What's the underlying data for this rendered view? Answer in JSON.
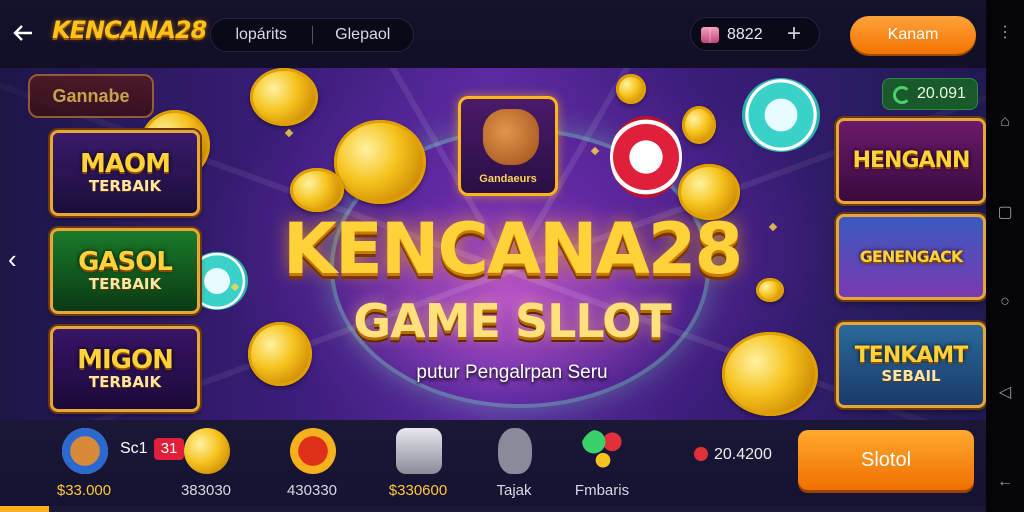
{
  "header": {
    "logo": "KENCANA28",
    "tabs": [
      "lopárits",
      "Glepaol"
    ],
    "coin_value": "8822",
    "action_button": "Kanam"
  },
  "banner": {
    "corner_brand": "Gannabe",
    "mascot_label": "Gandaeurs",
    "title": "KENCANA28",
    "subtitle": "GAME SLLOT",
    "tagline": "putur Pengalrpan Seru",
    "prize_value": "20.091",
    "left_tiles": [
      {
        "line1": "MAOM",
        "line2": "TERBAIK"
      },
      {
        "line1": "GASOL",
        "line2": "TERBAIK"
      },
      {
        "line1": "MIGON",
        "line2": "TERBAIK"
      }
    ],
    "right_tiles": [
      {
        "line1": "HENGANN",
        "line2": ""
      },
      {
        "line1": "GENENGACK",
        "line2": ""
      },
      {
        "line1": "TENKAMT",
        "line2": "SEBAIL"
      }
    ]
  },
  "bottom": {
    "badge_prefix": "Sc1",
    "badge_count": "31",
    "items": [
      {
        "caption": "$33.000",
        "icon": "dog-chip-icon"
      },
      {
        "caption": "383030",
        "icon": "gold-coin-icon"
      },
      {
        "caption": "430330",
        "icon": "bitcoin-icon"
      },
      {
        "caption": "$330600",
        "icon": "dice-cup-icon"
      },
      {
        "caption": "Tajak",
        "icon": "apple-icon"
      },
      {
        "caption": "Fmbaris",
        "icon": "gems-icon"
      }
    ],
    "balance": "20.4200",
    "slot_button": "Slotol"
  },
  "colors": {
    "accent": "#ffc21a",
    "button": "#f27400",
    "background": "#14122c"
  }
}
